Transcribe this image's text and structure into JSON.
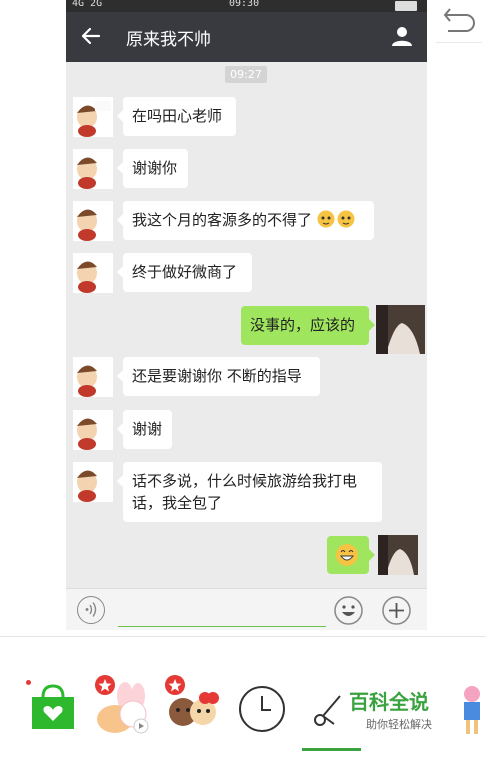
{
  "status_bar": {
    "signal": "4G 2G",
    "time": "09:30"
  },
  "header": {
    "title": "原来我不帅"
  },
  "chat": {
    "timestamp": "09:27",
    "messages": [
      {
        "side": "left",
        "text": "在吗田心老师"
      },
      {
        "side": "left",
        "text": "谢谢你"
      },
      {
        "side": "left",
        "text": "我这个月的客源多的不得了"
      },
      {
        "side": "left",
        "text": "终于做好微商了"
      },
      {
        "side": "right",
        "text": "没事的，应该的"
      },
      {
        "side": "left",
        "text": "还是要谢谢你 不断的指导"
      },
      {
        "side": "left",
        "text": "谢谢"
      },
      {
        "side": "left",
        "text": "话不多说，什么时候旅游给我打电话，我全包了"
      },
      {
        "side": "right",
        "text": ""
      }
    ]
  },
  "watermark": {
    "main": "百科全说",
    "sub": "助你轻松解决"
  },
  "colors": {
    "header": "#393a3f",
    "my_bubble": "#9fe55e",
    "accent": "#3aa23f",
    "chat_bg": "#ebebeb"
  },
  "icons": [
    "back-arrow-icon",
    "person-icon",
    "voice-icon",
    "emoji-icon",
    "plus-icon",
    "undo-icon",
    "shop-bag-icon",
    "clock-icon",
    "scissors-icon"
  ]
}
